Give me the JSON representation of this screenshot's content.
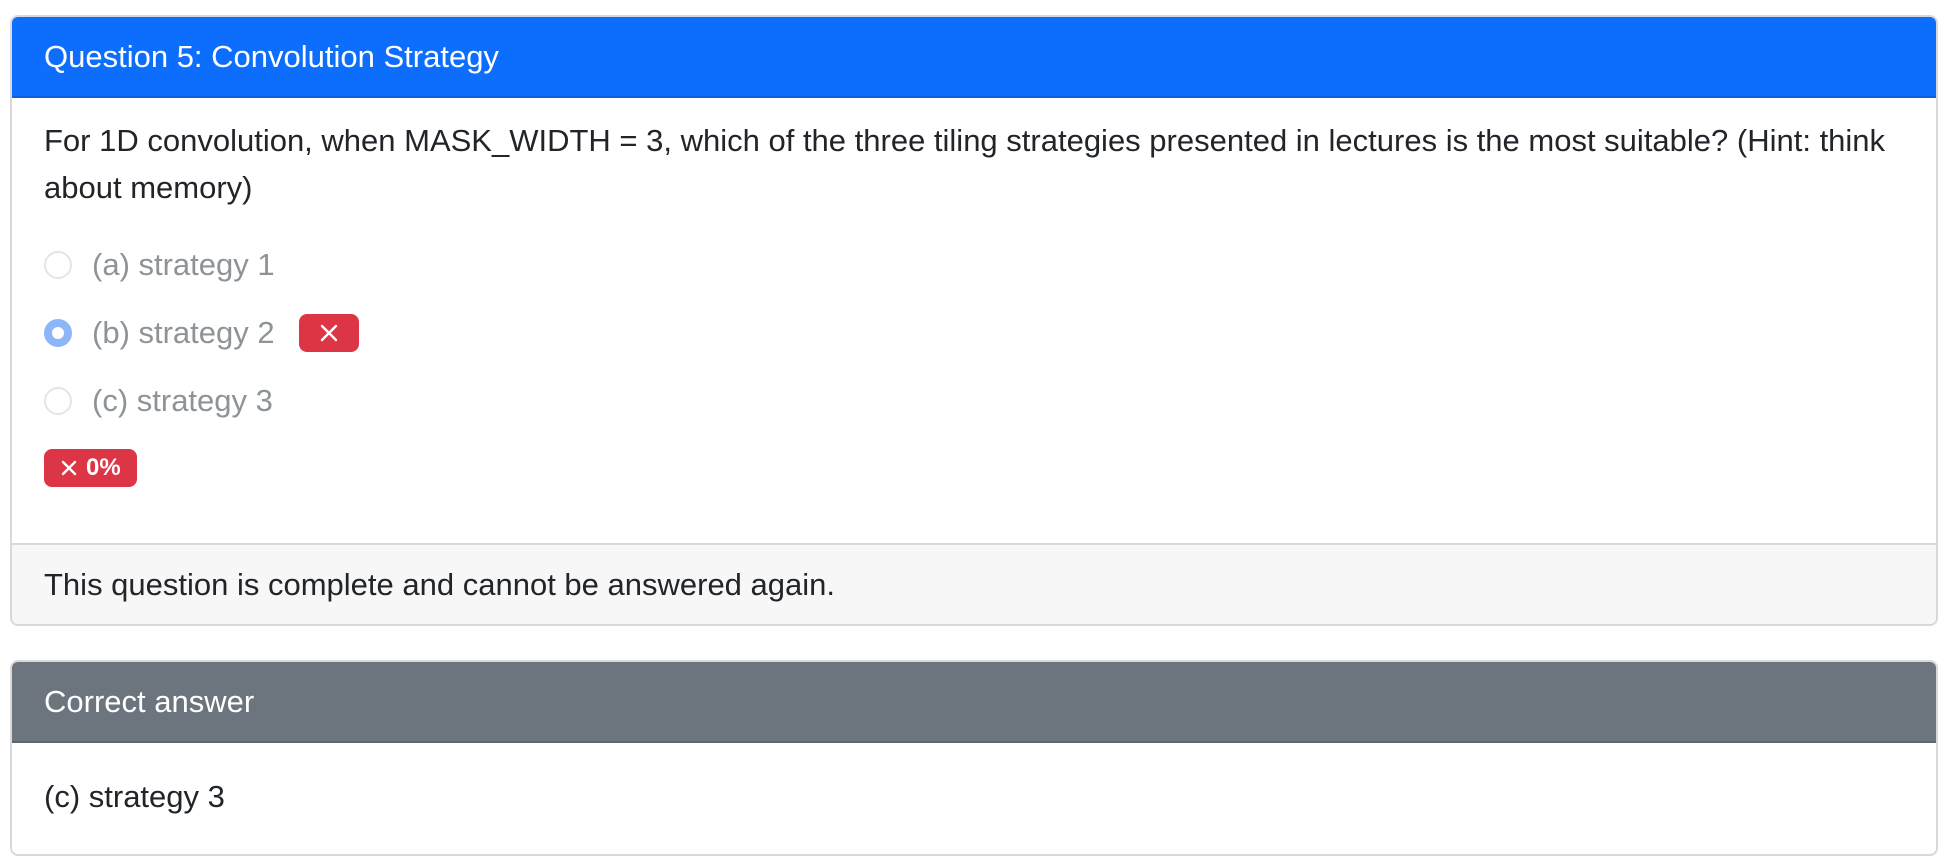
{
  "question_card": {
    "title": "Question 5: Convolution Strategy",
    "prompt": "For 1D convolution, when MASK_WIDTH = 3, which of the three tiling strategies presented in lectures is the most suitable? (Hint: think about memory)",
    "options": [
      {
        "label": "(a) strategy 1",
        "selected": false
      },
      {
        "label": "(b) strategy 2",
        "selected": true,
        "marked": "incorrect"
      },
      {
        "label": "(c) strategy 3",
        "selected": false
      }
    ],
    "score": "0%",
    "footer": "This question is complete and cannot be answered again.",
    "colors": {
      "header": "#0d6efd",
      "danger": "#dc3545",
      "radio_selected": "#8db6fa"
    }
  },
  "answer_card": {
    "title": "Correct answer",
    "answer": "(c) strategy 3",
    "colors": {
      "header": "#6c757d"
    }
  },
  "icons": {
    "wrong_badge_icon": "x-icon",
    "score_badge_icon": "x-icon"
  }
}
